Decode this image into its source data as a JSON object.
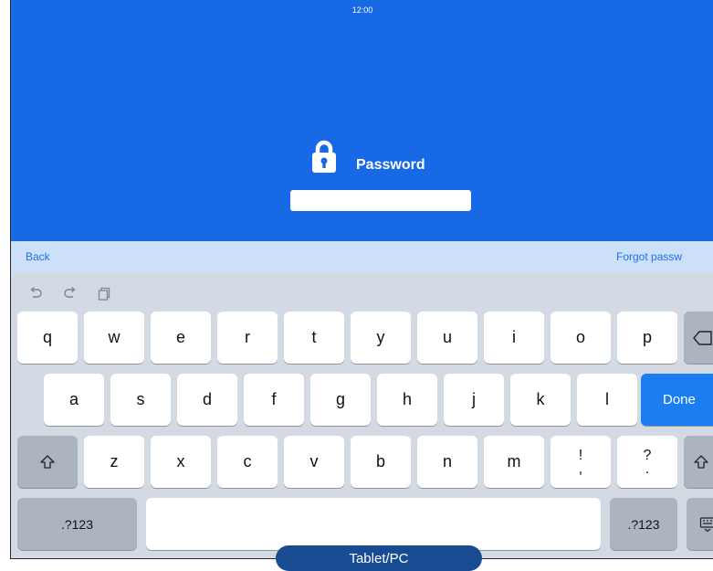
{
  "status_bar": {
    "time": "12:00"
  },
  "login": {
    "lock_icon": "lock-icon",
    "label": "Password",
    "input_value": ""
  },
  "accessory": {
    "back_label": "Back",
    "forgot_label": "Forgot passw"
  },
  "keyboard": {
    "toolbar_icons": [
      "undo-icon",
      "redo-icon",
      "paste-icon"
    ],
    "row1": [
      "q",
      "w",
      "e",
      "r",
      "t",
      "y",
      "u",
      "i",
      "o",
      "p"
    ],
    "row2": [
      "a",
      "s",
      "d",
      "f",
      "g",
      "h",
      "j",
      "k",
      "l"
    ],
    "done_label": "Done",
    "row3": [
      "z",
      "x",
      "c",
      "v",
      "b",
      "n",
      "m"
    ],
    "row3_punct": [
      {
        "top": "!",
        "bottom": ","
      },
      {
        "top": "?",
        "bottom": "."
      }
    ],
    "numbers_label_left": ".?123",
    "numbers_label_right": ".?123",
    "accent_color": "#1a7ef0",
    "background_color": "#1769e6"
  },
  "caption": {
    "label": "Tablet/PC"
  }
}
